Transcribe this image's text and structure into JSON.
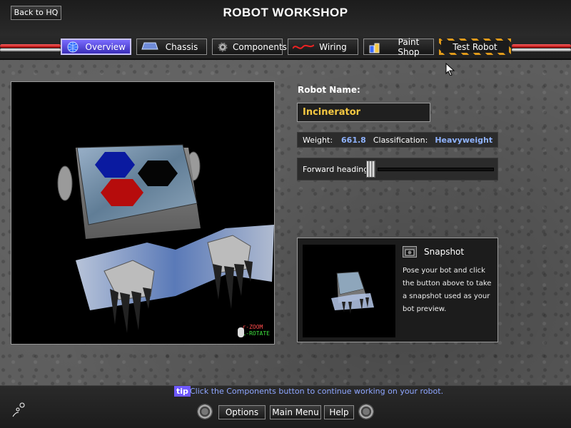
{
  "header": {
    "title": "ROBOT WORKSHOP",
    "back_label": "Back to HQ"
  },
  "tabs": [
    {
      "label": "Overview",
      "icon": "globe-icon",
      "active": true
    },
    {
      "label": "Chassis",
      "icon": "chassis-icon",
      "active": false
    },
    {
      "label": "Components",
      "icon": "gear-icon",
      "active": false
    },
    {
      "label": "Wiring",
      "icon": "wire-icon",
      "active": false
    },
    {
      "label": "Paint Shop",
      "icon": "paint-cans-icon",
      "active": false
    },
    {
      "label": "Test Robot",
      "icon": "",
      "active": false
    }
  ],
  "viewport": {
    "zoom_label": "ZOOM",
    "rotate_label": "ROTATE"
  },
  "robot": {
    "name_label": "Robot Name:",
    "name_value": "Incinerator",
    "weight_label": "Weight:",
    "weight_value": "661.8",
    "class_label": "Classification:",
    "class_value": "Heavyweight",
    "heading_label": "Forward heading:",
    "heading_level": 0
  },
  "snapshot": {
    "title": "Snapshot",
    "description": "Pose your bot and click the button above to take a snapshot used as your bot preview."
  },
  "footer": {
    "tip_badge": "tip",
    "tip_text": "Click the Components button to continue working on your robot.",
    "options_label": "Options",
    "main_menu_label": "Main Menu",
    "help_label": "Help"
  },
  "colors": {
    "accent": "#6f59ff",
    "name_text": "#f5c842",
    "stat_value": "#8fb3ff",
    "tip_text": "#8ea6ff"
  }
}
